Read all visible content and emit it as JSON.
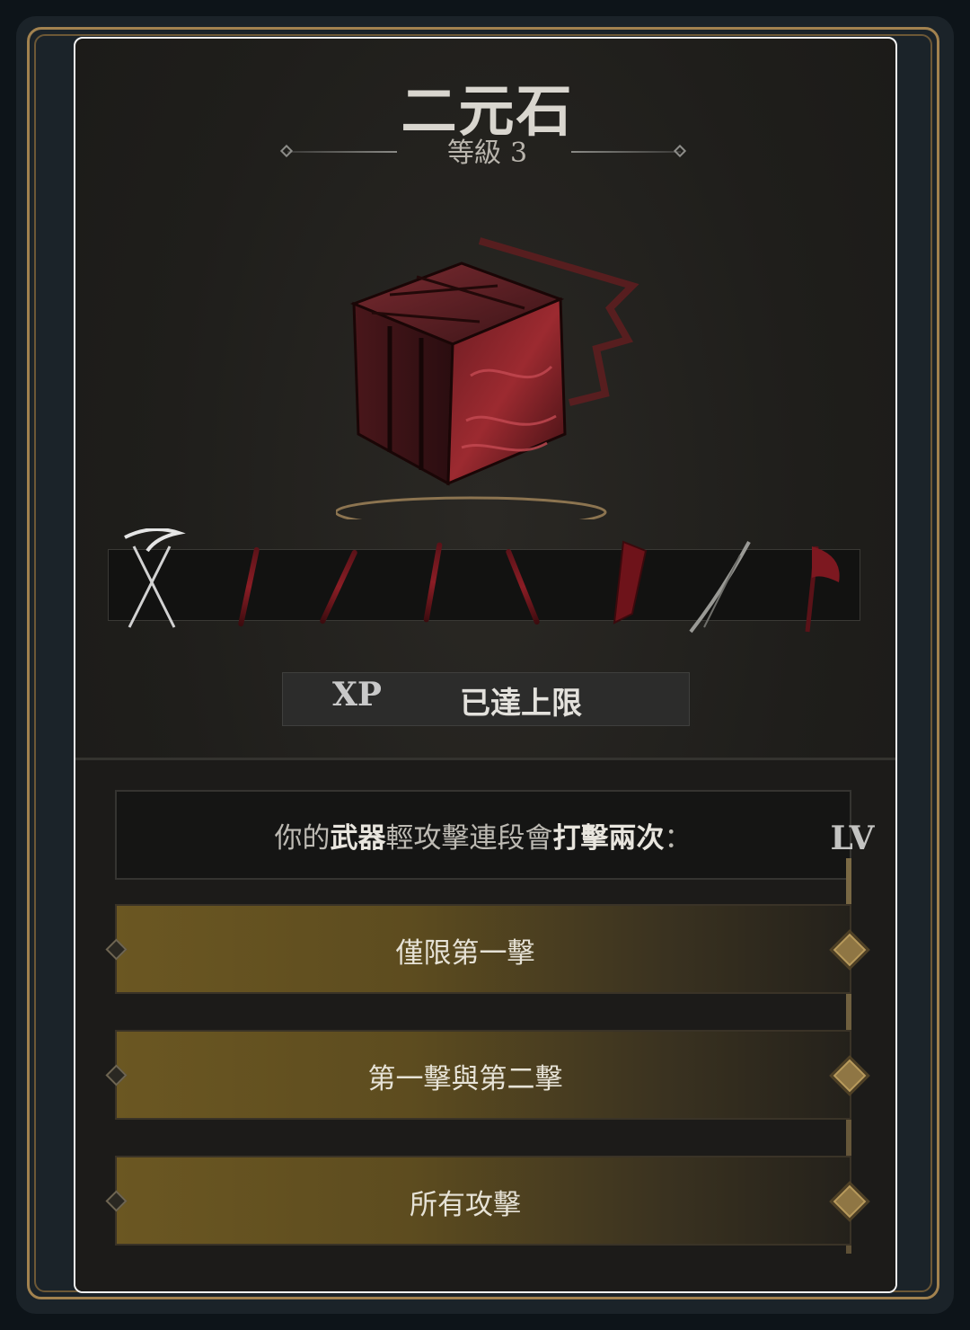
{
  "item": {
    "name": "二元石",
    "level_label": "等級",
    "level_value": "3"
  },
  "weapon_row": {
    "icons": [
      "scythe-icon",
      "greatsword-icon",
      "spear-icon",
      "sword-icon",
      "staff-icon",
      "shield-icon",
      "bow-icon",
      "axe-icon"
    ]
  },
  "xp": {
    "icon_label": "XP",
    "status": "已達上限"
  },
  "description": {
    "part1": "你的",
    "bold1": "武器",
    "part2": "輕攻擊連段會",
    "bold2": "打擊兩次",
    "part3": "："
  },
  "level_badge": "LV",
  "options": [
    {
      "label": "僅限第一擊"
    },
    {
      "label": "第一擊與第二擊"
    },
    {
      "label": "所有攻擊"
    }
  ],
  "colors": {
    "accent_gold": "#a2824f",
    "option_fill": "#6b5722",
    "stone_red": "#8b1d25"
  }
}
